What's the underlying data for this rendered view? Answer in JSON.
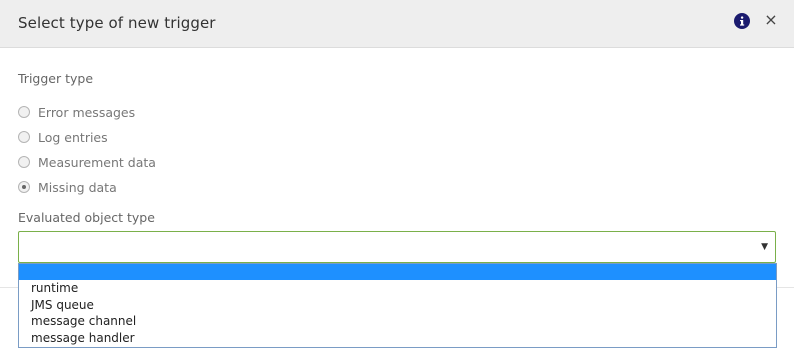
{
  "dialog": {
    "title": "Select type of new trigger",
    "info_icon": "info-circle-icon",
    "close_icon": "close-icon",
    "close_glyph": "×"
  },
  "trigger_type": {
    "label": "Trigger type",
    "options": [
      {
        "label": "Error messages",
        "checked": false
      },
      {
        "label": "Log entries",
        "checked": false
      },
      {
        "label": "Measurement data",
        "checked": false
      },
      {
        "label": "Missing data",
        "checked": true
      }
    ]
  },
  "evaluated_object_type": {
    "label": "Evaluated object type",
    "selected_value": "",
    "arrow_glyph": "▼",
    "options": [
      {
        "label": "",
        "selected": true
      },
      {
        "label": "runtime",
        "selected": false
      },
      {
        "label": "JMS queue",
        "selected": false
      },
      {
        "label": "message channel",
        "selected": false
      },
      {
        "label": "message handler",
        "selected": false
      }
    ]
  },
  "colors": {
    "header_bg": "#eeeeee",
    "select_border": "#7ab04a",
    "option_highlight": "#1e90ff",
    "info_icon": "#1a1a6e"
  }
}
